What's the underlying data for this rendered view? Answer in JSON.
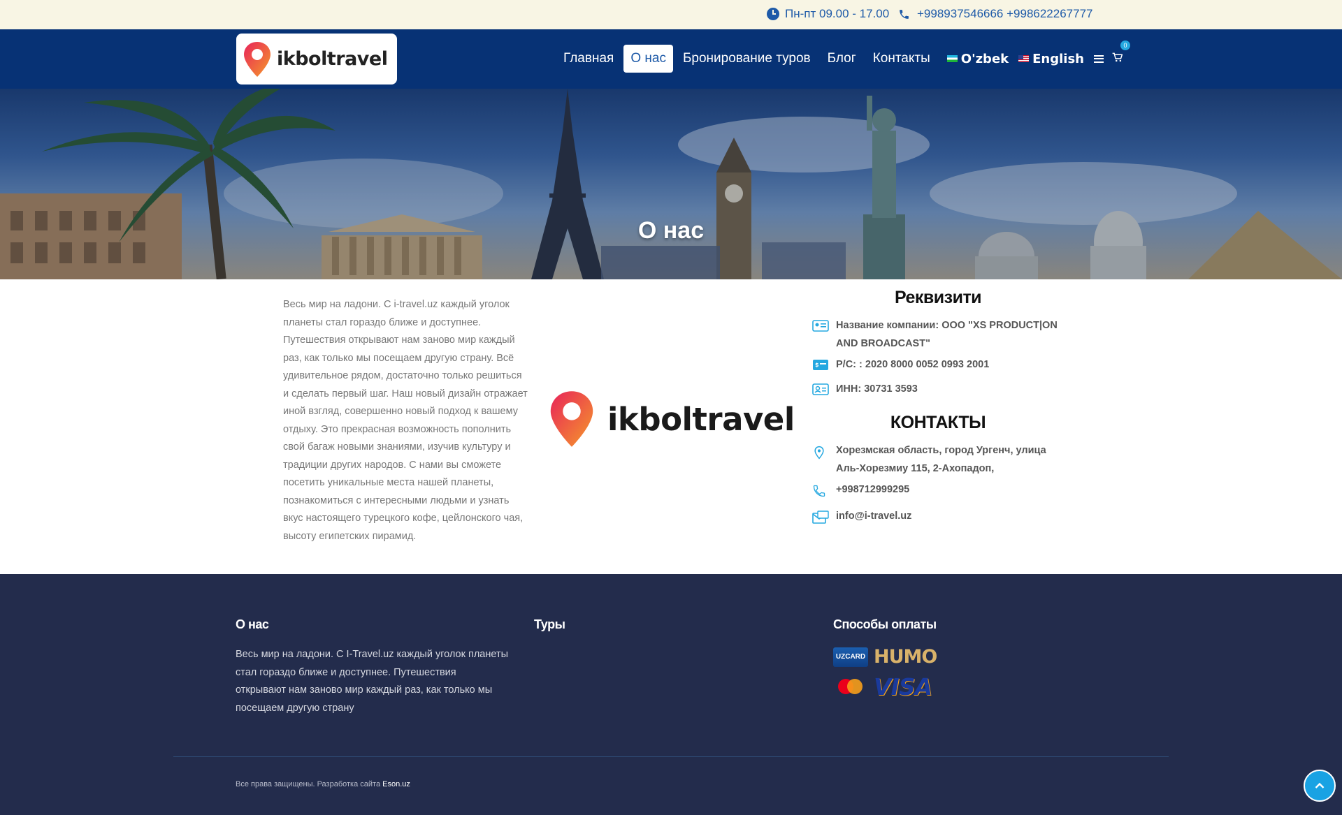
{
  "topbar": {
    "hours": "Пн-пт 09.00 - 17.00",
    "phones": "+998937546666 +998622267777"
  },
  "nav": {
    "logo_text": "ikboltravel",
    "items": [
      {
        "label": "Главная",
        "active": false
      },
      {
        "label": "О нас",
        "active": true
      },
      {
        "label": "Бронирование туров",
        "active": false
      },
      {
        "label": "Блог",
        "active": false
      },
      {
        "label": "Контакты",
        "active": false
      }
    ],
    "lang_uz": "O'zbek",
    "lang_en": "English",
    "cart_count": "0"
  },
  "hero": {
    "title": "О нас"
  },
  "about": {
    "text": "Весь мир на ладони. С i-travel.uz каждый уголок планеты стал гораздо ближе и доступнее. Путешествия открывают нам заново мир каждый раз, как только мы посещаем другую страну. Всё удивительное рядом, достаточно только решиться и сделать первый шаг. Наш новый дизайн отражает иной взгляд, совершенно новый подход к вашему отдыху. Это прекрасная возможность пополнить свой багаж новыми знаниями, изучив культуру и традиции других народов. С нами вы сможете посетить уникальные места нашей планеты, познакомиться с интересными людьми и узнать вкус настоящего турецкого кофе, цейлонского чая, высоту египетских пирамид.",
    "logo_text": "ikboltravel"
  },
  "requisites": {
    "title": "Реквизити",
    "company": "Название компании: ООО \"XS PRODUCT|ON AND BROADCAST\"",
    "account": "Р/С: : 2020 8000 0052 0993 2001",
    "inn": "ИНН: 30731 3593"
  },
  "contacts": {
    "title": "КОНТАКТЫ",
    "address": "Хорезмская область, город Ургенч, улица Аль-Хорезмиу 115, 2-Ахопадоп,",
    "phone": "+998712999295",
    "email": "info@i-travel.uz"
  },
  "footer": {
    "about_title": "О нас",
    "about_text": "Весь мир на ладони. С I-Travel.uz каждый уголок планеты стал гораздо ближе и доступнее. Путешествия открывают нам заново мир каждый раз, как только мы посещаем другую страну",
    "tours_title": "Туры",
    "payment_title": "Способы оплаты",
    "payment_methods": [
      "UZCARD",
      "HUMO",
      "Mastercard",
      "VISA"
    ],
    "copyright": "Все права защищены. Разработка сайта ",
    "developer": "Eson.uz"
  },
  "colors": {
    "topbar_bg": "#f8f5e4",
    "navbar_bg": "#073275",
    "accent": "#1e5aa8",
    "footer_bg": "#232c4c",
    "scroll_button": "#19a2e3"
  },
  "icons": [
    "clock-icon",
    "phone-icon",
    "menu-icon",
    "cart-icon",
    "location-pin-logo-icon",
    "id-card-icon",
    "money-card-icon",
    "contact-card-icon",
    "map-pin-icon",
    "phone-icon",
    "mail-icon",
    "chevron-up-icon"
  ]
}
